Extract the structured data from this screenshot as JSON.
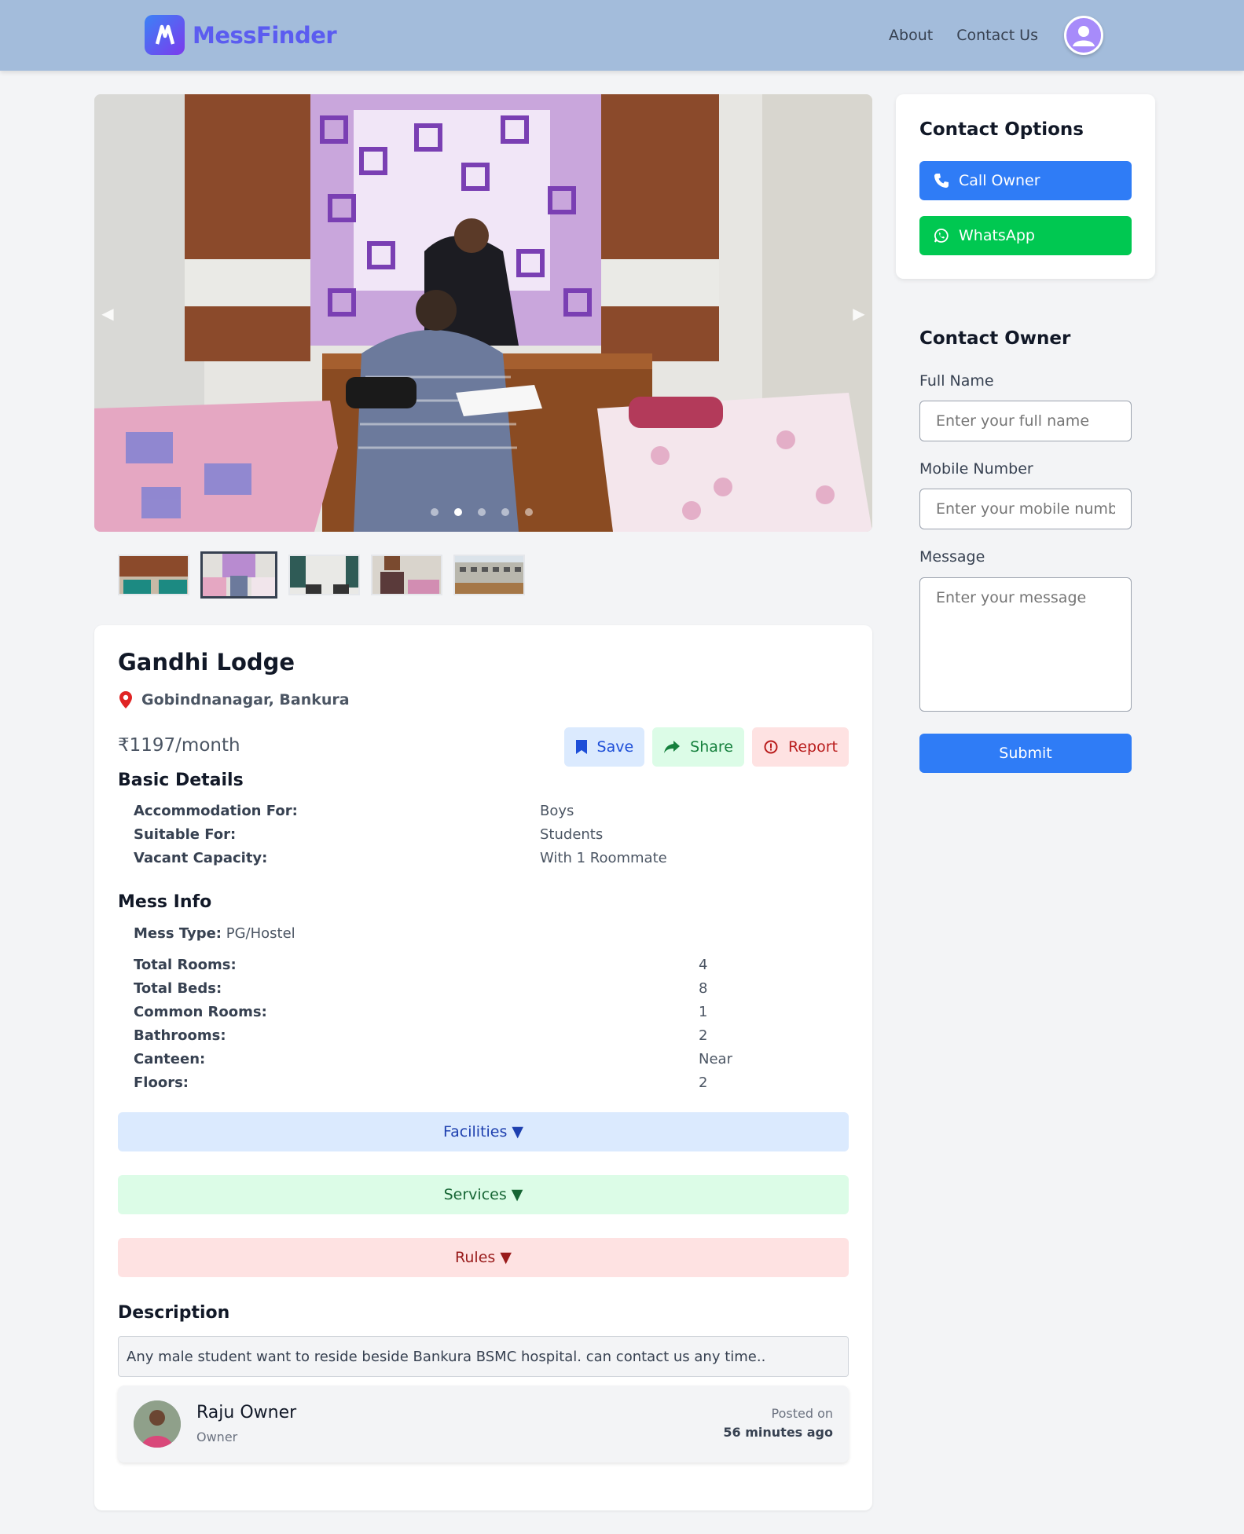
{
  "header": {
    "brand": "MessFinder",
    "nav": {
      "about": "About",
      "contact": "Contact Us"
    }
  },
  "gallery": {
    "image_count": 5,
    "active_index": 1
  },
  "listing": {
    "title": "Gandhi Lodge",
    "location": "Gobindnanagar, Bankura",
    "price": "₹1197/month",
    "actions": {
      "save": "Save",
      "share": "Share",
      "report": "Report"
    }
  },
  "basic_details": {
    "heading": "Basic Details",
    "rows": [
      {
        "label": "Accommodation For:",
        "value": "Boys"
      },
      {
        "label": "Suitable For:",
        "value": "Students"
      },
      {
        "label": "Vacant Capacity:",
        "value": "With 1 Roommate"
      }
    ]
  },
  "mess_info": {
    "heading": "Mess Info",
    "type_label": "Mess Type:",
    "type_value": "PG/Hostel",
    "rows": [
      {
        "label": "Total Rooms:",
        "value": "4"
      },
      {
        "label": "Total Beds:",
        "value": "8"
      },
      {
        "label": "Common Rooms:",
        "value": "1"
      },
      {
        "label": "Bathrooms:",
        "value": "2"
      },
      {
        "label": "Canteen:",
        "value": "Near"
      },
      {
        "label": "Floors:",
        "value": "2"
      }
    ]
  },
  "accordions": {
    "facilities": "Facilities ▼",
    "services": "Services ▼",
    "rules": "Rules ▼"
  },
  "description": {
    "heading": "Description",
    "text": "Any male student want to reside beside Bankura BSMC hospital. can contact us any time.."
  },
  "owner": {
    "name": "Raju Owner",
    "role": "Owner",
    "posted_label": "Posted on",
    "posted_value": "56 minutes ago"
  },
  "contact_options": {
    "heading": "Contact Options",
    "call": "Call Owner",
    "whatsapp": "WhatsApp"
  },
  "contact_form": {
    "heading": "Contact Owner",
    "name_label": "Full Name",
    "name_placeholder": "Enter your full name",
    "mobile_label": "Mobile Number",
    "mobile_placeholder": "Enter your mobile number",
    "message_label": "Message",
    "message_placeholder": "Enter your message",
    "submit": "Submit"
  },
  "colors": {
    "header_bg": "#a3bcdb",
    "brand": "#5b5cf0",
    "primary": "#2f7cf6",
    "whatsapp": "#00c851"
  }
}
